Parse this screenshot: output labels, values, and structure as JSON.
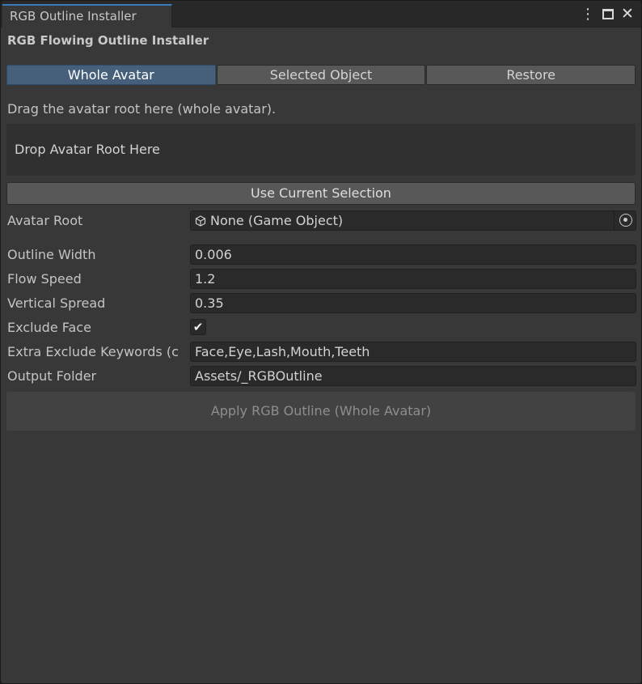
{
  "window": {
    "tab_title": "RGB Outline Installer",
    "kebab_icon": "kebab-menu-icon",
    "maximize_icon": "maximize-icon",
    "close_icon": "close-icon"
  },
  "header": {
    "title": "RGB Flowing Outline Installer"
  },
  "toolbar": {
    "tabs": [
      {
        "label": "Whole Avatar",
        "active": true
      },
      {
        "label": "Selected Object",
        "active": false
      },
      {
        "label": "Restore",
        "active": false
      }
    ]
  },
  "hint": "Drag the avatar root here (whole avatar).",
  "dropzone": {
    "label": "Drop Avatar Root Here"
  },
  "use_selection_label": "Use Current Selection",
  "fields": {
    "avatar_root": {
      "label": "Avatar Root",
      "value": "None (Game Object)",
      "icon": "cube-icon",
      "picker_icon": "object-picker-icon"
    },
    "outline_width": {
      "label": "Outline Width",
      "value": "0.006"
    },
    "flow_speed": {
      "label": "Flow Speed",
      "value": "1.2"
    },
    "vertical_spread": {
      "label": "Vertical Spread",
      "value": "0.35"
    },
    "exclude_face": {
      "label": "Exclude Face",
      "checked": true
    },
    "extra_exclude": {
      "label": "Extra Exclude Keywords (c",
      "value": "Face,Eye,Lash,Mouth,Teeth"
    },
    "output_folder": {
      "label": "Output Folder",
      "value": "Assets/_RGBOutline"
    }
  },
  "apply_label": "Apply RGB Outline (Whole Avatar)",
  "colors": {
    "accent": "#3a79bb",
    "active_tab": "#46607c",
    "background": "#383838"
  }
}
